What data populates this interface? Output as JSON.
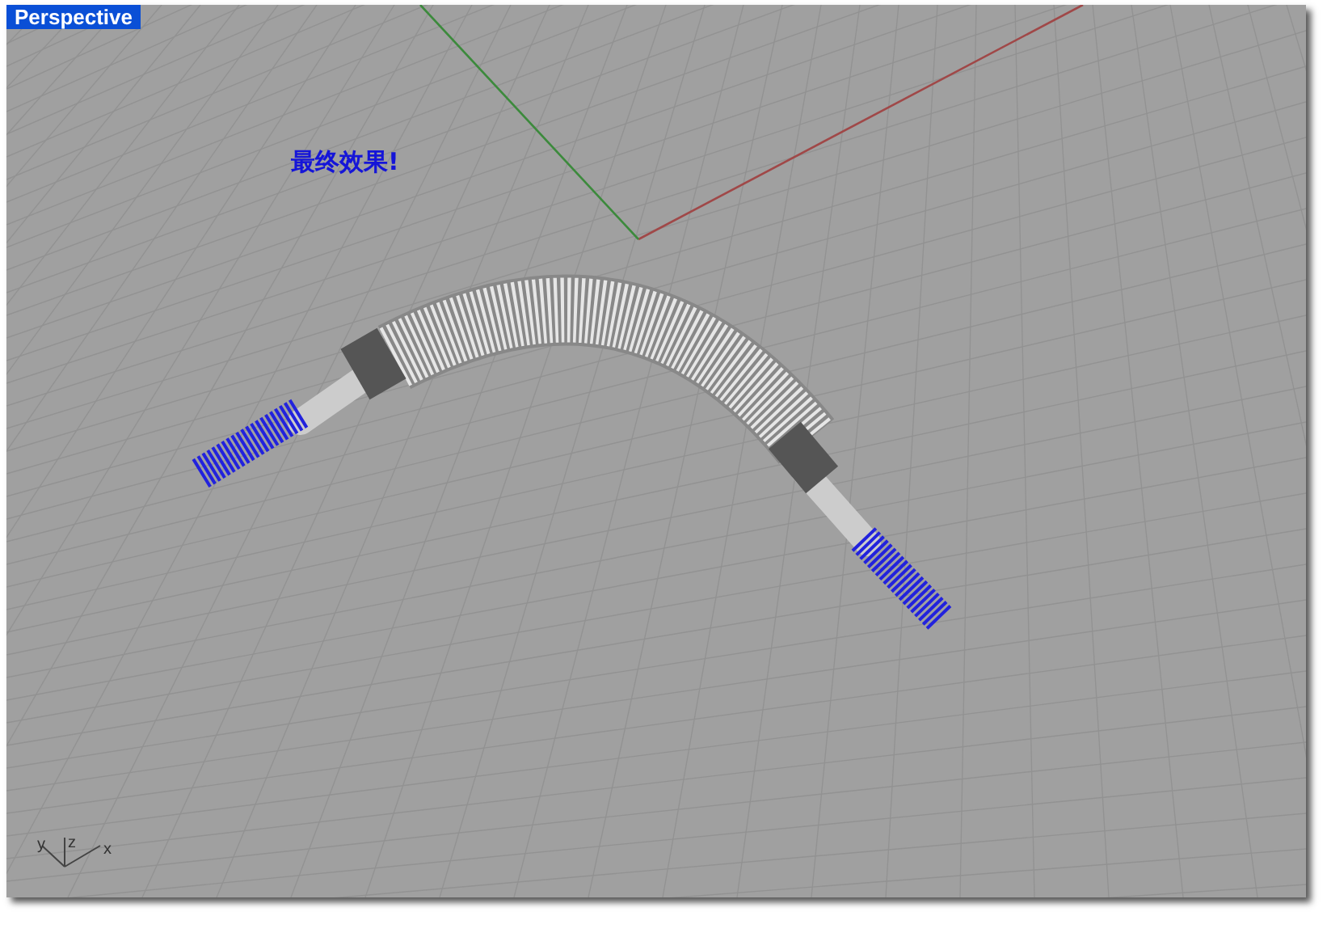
{
  "viewport": {
    "title": "Perspective"
  },
  "annotation": "最终效果!",
  "axis_labels": [
    "y",
    "z",
    "x"
  ]
}
